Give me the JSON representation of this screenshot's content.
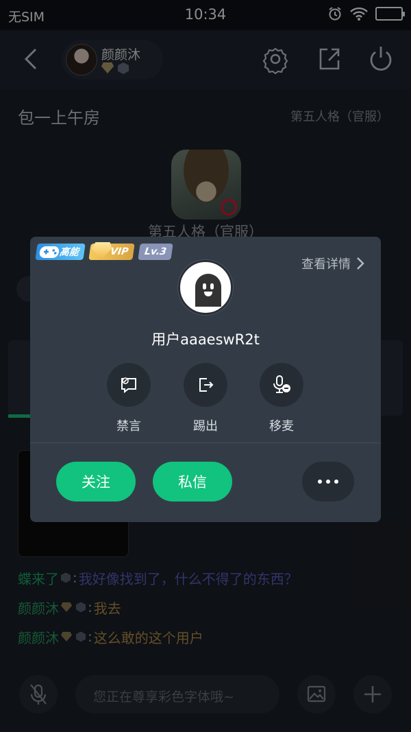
{
  "status_bar": {
    "carrier": "无SIM",
    "time": "10:34"
  },
  "header": {
    "host_name": "颜颜沐"
  },
  "room": {
    "title": "包一上午房",
    "game_tag": "第五人格（官服）",
    "game_name": "第五人格（官服）"
  },
  "profile_card": {
    "tags": {
      "power": "高能",
      "vip": "VIP",
      "level": "Lv.3"
    },
    "details_link": "查看详情",
    "username": "用户aaaeswR2t",
    "actions": [
      {
        "label": "禁言",
        "icon": "mute-chat-icon"
      },
      {
        "label": "踢出",
        "icon": "kick-out-icon"
      },
      {
        "label": "移麦",
        "icon": "remove-mic-icon"
      }
    ],
    "follow_label": "关注",
    "message_label": "私信"
  },
  "chat": [
    {
      "name": "蝶来了",
      "colon": ":",
      "text": "我好像找到了，什么不得了的东西？"
    },
    {
      "name": "颜颜沐",
      "colon": ":",
      "text": "我去"
    },
    {
      "name": "颜颜沐",
      "colon": ":",
      "text": "这么敢的这个用户"
    }
  ],
  "input": {
    "placeholder": "您正在尊享彩色字体哦~"
  },
  "colors": {
    "accent_green": "#11c37e",
    "card_bg": "#333c46",
    "page_bg": "#1b1f27"
  }
}
